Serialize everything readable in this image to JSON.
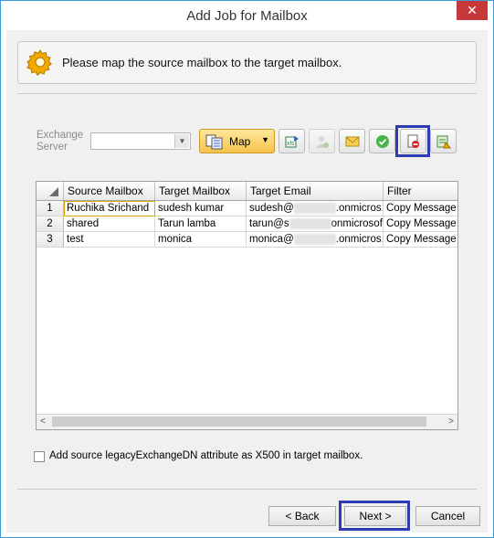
{
  "window": {
    "title": "Add Job for Mailbox",
    "close_glyph": "✕"
  },
  "banner": {
    "icon": "gear-icon",
    "text": "Please map the source mailbox to the target mailbox."
  },
  "toolbar": {
    "exchange_label": "Exchange Server",
    "exchange_value": "",
    "map_label": "Map",
    "buttons": [
      "export-mapping-icon",
      "add-user-icon",
      "email-icon",
      "validate-check-icon",
      "remove-mapping-icon",
      "filter-settings-icon"
    ]
  },
  "grid": {
    "columns": [
      "Source Mailbox",
      "Target Mailbox",
      "Target Email",
      "Filter"
    ],
    "rows": [
      {
        "n": "1",
        "source": "Ruchika Srichand",
        "target": "sudesh kumar",
        "email_pre": "sudesh@",
        "email_post": ".onmicros...",
        "filter": "Copy Message C"
      },
      {
        "n": "2",
        "source": "shared",
        "target": "Tarun lamba",
        "email_pre": "tarun@s",
        "email_post": "onmicrosoft....",
        "filter": "Copy Message C"
      },
      {
        "n": "3",
        "source": "test",
        "target": "monica",
        "email_pre": "monica@",
        "email_post": ".onmicros...",
        "filter": "Copy Message C"
      }
    ]
  },
  "option": {
    "label": "Add source legacyExchangeDN attribute as X500 in target mailbox.",
    "checked": false
  },
  "buttons": {
    "back": "< Back",
    "next": "Next >",
    "cancel": "Cancel"
  },
  "colors": {
    "highlight": "#2e3bb2",
    "accent": "#3c9bd6",
    "close": "#c7383a"
  }
}
